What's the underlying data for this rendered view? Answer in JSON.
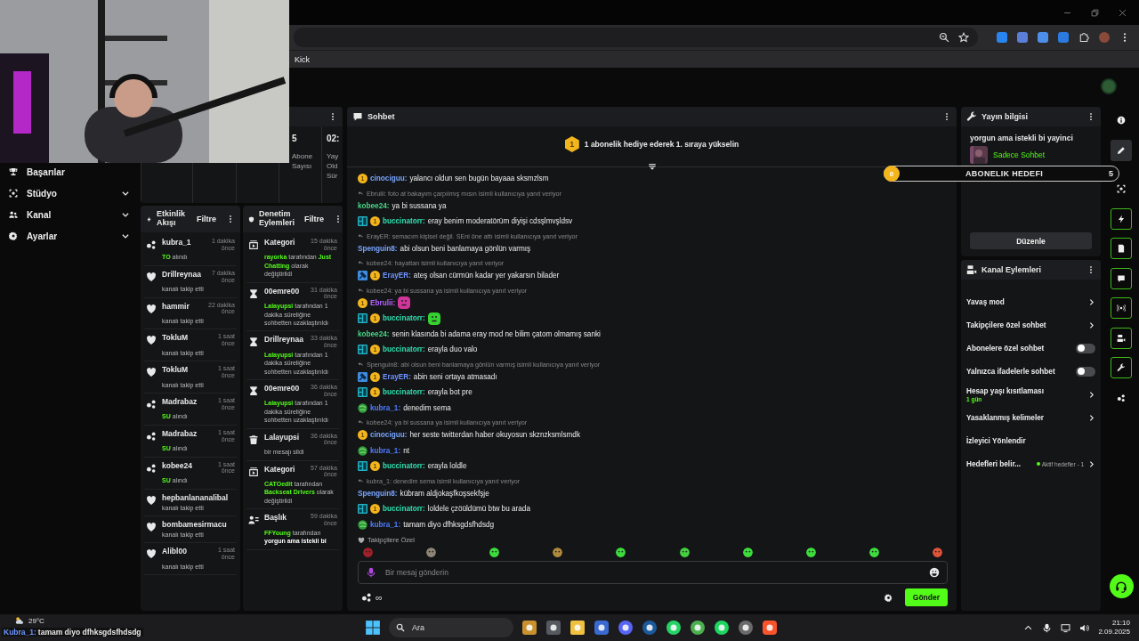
{
  "browser": {
    "bookmarks": [
      {
        "label": "Kick"
      }
    ]
  },
  "sidebar": {
    "items": [
      {
        "label": "Başarılar",
        "kind": "link"
      },
      {
        "label": "Stüdyo",
        "kind": "group"
      },
      {
        "label": "Kanal",
        "kind": "group"
      },
      {
        "label": "Ayarlar",
        "kind": "group"
      }
    ]
  },
  "stats": {
    "cells": [
      {
        "value": "5",
        "label": "Abone Sayısı"
      },
      {
        "value": "02:",
        "label": "Yay Old Sür"
      }
    ]
  },
  "activity_feed": {
    "title": "Etkinlik Akışı",
    "filter": "Filtre",
    "items": [
      {
        "kind": "gift",
        "user": "kubra_1",
        "time": "1 dakika önce",
        "parts": [
          {
            "kind": "accent",
            "text": "TO"
          },
          {
            "kind": "plain",
            "text": " alındı"
          }
        ]
      },
      {
        "kind": "follow",
        "user": "Drillreynaa",
        "time": "7 dakika önce",
        "parts": [
          {
            "kind": "plain",
            "text": "kanalı takip etti"
          }
        ]
      },
      {
        "kind": "follow",
        "user": "hammir",
        "time": "22 dakika önce",
        "parts": [
          {
            "kind": "plain",
            "text": "kanalı takip etti"
          }
        ]
      },
      {
        "kind": "follow",
        "user": "TokluM",
        "time": "1 saat önce",
        "parts": [
          {
            "kind": "plain",
            "text": "kanalı takip etti"
          }
        ]
      },
      {
        "kind": "follow",
        "user": "TokluM",
        "time": "1 saat önce",
        "parts": [
          {
            "kind": "plain",
            "text": "kanalı takip etti"
          }
        ]
      },
      {
        "kind": "gift",
        "user": "Madrabaz",
        "time": "1 saat önce",
        "parts": [
          {
            "kind": "accent",
            "text": "SU"
          },
          {
            "kind": "plain",
            "text": " alındı"
          }
        ]
      },
      {
        "kind": "gift",
        "user": "Madrabaz",
        "time": "1 saat önce",
        "parts": [
          {
            "kind": "accent",
            "text": "SU"
          },
          {
            "kind": "plain",
            "text": " alındı"
          }
        ]
      },
      {
        "kind": "gift",
        "user": "kobee24",
        "time": "1 saat önce",
        "parts": [
          {
            "kind": "accent",
            "text": "SU"
          },
          {
            "kind": "plain",
            "text": " alındı"
          }
        ]
      },
      {
        "kind": "follow",
        "user": "hepbanlananalibal",
        "parts": [
          {
            "kind": "plain",
            "text": "kanalı takip etti"
          }
        ]
      },
      {
        "kind": "follow",
        "user": "bombamesirmacu",
        "parts": [
          {
            "kind": "plain",
            "text": "kanalı takip etti"
          }
        ]
      },
      {
        "kind": "follow",
        "user": "Alibl00",
        "time": "1 saat önce",
        "parts": [
          {
            "kind": "plain",
            "text": "kanalı takip etti"
          }
        ]
      }
    ]
  },
  "moderation_feed": {
    "title": "Denetim Eylemleri",
    "filter": "Filtre",
    "items": [
      {
        "kind": "category",
        "user": "Kategori",
        "time": "15 dakika önce",
        "parts": [
          {
            "kind": "accent",
            "text": "rayorka"
          },
          {
            "kind": "plain",
            "text": " tarafından "
          },
          {
            "kind": "accent",
            "text": "Just Chatting"
          },
          {
            "kind": "plain",
            "text": " olarak değiştirildi"
          }
        ]
      },
      {
        "kind": "timeout",
        "user": "00emre00",
        "time": "31 dakika önce",
        "parts": [
          {
            "kind": "accent",
            "text": "Lalayupsi"
          },
          {
            "kind": "plain",
            "text": " tarafından 1 dakika süreliğine sohbetten uzaklaştırıldı"
          }
        ]
      },
      {
        "kind": "timeout",
        "user": "Drillreynaa",
        "time": "33 dakika önce",
        "parts": [
          {
            "kind": "accent",
            "text": "Lalayupsi"
          },
          {
            "kind": "plain",
            "text": " tarafından 1 dakika süreliğine sohbetten uzaklaştırıldı"
          }
        ]
      },
      {
        "kind": "timeout",
        "user": "00emre00",
        "time": "36 dakika önce",
        "parts": [
          {
            "kind": "accent",
            "text": "Lalayupsi"
          },
          {
            "kind": "plain",
            "text": " tarafından 1 dakika süreliğine sohbetten uzaklaştırıldı"
          }
        ]
      },
      {
        "kind": "delete",
        "user": "Lalayupsi",
        "time": "36 dakika önce",
        "parts": [
          {
            "kind": "plain",
            "text": "bir mesajı sildi"
          }
        ]
      },
      {
        "kind": "category",
        "user": "Kategori",
        "time": "57 dakika önce",
        "parts": [
          {
            "kind": "accent",
            "text": "CATOedit"
          },
          {
            "kind": "plain",
            "text": " tarafından "
          },
          {
            "kind": "accent",
            "text": "Backseat Drivers"
          },
          {
            "kind": "plain",
            "text": " olarak değiştirildi"
          }
        ]
      },
      {
        "kind": "title",
        "user": "Başlık",
        "time": "59 dakika önce",
        "parts": [
          {
            "kind": "accent",
            "text": "FFYoung"
          },
          {
            "kind": "plain",
            "text": " tarafından "
          },
          {
            "kind": "strong",
            "text": "yorgun ama istekli bi"
          }
        ]
      }
    ]
  },
  "chat": {
    "title": "Sohbet",
    "pinned": {
      "rank": "1",
      "text": "1 abonelik hediye ederek 1. sıraya yükselin"
    },
    "messages": [
      {
        "badges": [
          {
            "kind": "sub",
            "label": "1"
          }
        ],
        "user": "cinociguu:",
        "color": "#7aa6ff",
        "text": "yalancı oldun sen bugün bayaaa sksmzlsm"
      },
      {
        "reply": "Ebrulii: foto at bakayım çarpılmış mısın isimli kullanıcıya yanıt veriyor",
        "user": "kobee24:",
        "color": "#45d483",
        "text": "ya bi sussana ya"
      },
      {
        "badges": [
          {
            "kind": "mod"
          },
          {
            "kind": "sub",
            "label": "1"
          }
        ],
        "user": "buccinatorr:",
        "color": "#2fe0b0",
        "text": "eray benim moderatörüm diyişi cdsşlmvşldsv"
      },
      {
        "reply": "ErayER: semacım kişisel değil. SEni öne attı isimli kullanıcıya yanıt veriyor",
        "user": "Spenguin8:",
        "color": "#7aa6ff",
        "text": "abi olsun beni banlamaya gönlün varmış"
      },
      {
        "reply": "kobee24: hayattan isimli kullanıcıya yanıt veriyor",
        "badges": [
          {
            "kind": "staff"
          },
          {
            "kind": "sub",
            "label": "1"
          }
        ],
        "user": "ErayER:",
        "color": "#6f95ff",
        "text": "ateş olsan cürmün kadar yer yakarsın bilader"
      },
      {
        "reply": "kobee24: ya bi sussana ya isimli kullanıcıya yanıt veriyor",
        "badges": [
          {
            "kind": "sub",
            "label": "1"
          }
        ],
        "user": "Ebrulii:",
        "color": "#b463ff",
        "emote": {
          "color": "#d0359a"
        }
      },
      {
        "badges": [
          {
            "kind": "mod"
          },
          {
            "kind": "sub",
            "label": "1"
          }
        ],
        "user": "buccinatorr:",
        "color": "#2fe0b0",
        "emote": {
          "color": "#35d22f"
        }
      },
      {
        "user": "kobee24:",
        "color": "#45d483",
        "text": "senin klasında bi adama eray mod ne bilim çatom olmamış sanki"
      },
      {
        "badges": [
          {
            "kind": "mod"
          },
          {
            "kind": "sub",
            "label": "1"
          }
        ],
        "user": "buccinatorr:",
        "color": "#2fe0b0",
        "text": "erayla duo valo"
      },
      {
        "reply": "Spenguin8: abi olsun beni banlamaya gönlün varmış isimli kullanıcıya yanıt veriyor",
        "badges": [
          {
            "kind": "staff"
          },
          {
            "kind": "sub",
            "label": "1"
          }
        ],
        "user": "ErayER:",
        "color": "#6f95ff",
        "text": "abin seni ortaya atmasadı"
      },
      {
        "badges": [
          {
            "kind": "mod"
          },
          {
            "kind": "sub",
            "label": "1"
          }
        ],
        "user": "buccinatorr:",
        "color": "#2fe0b0",
        "text": "erayla bot pre"
      },
      {
        "badges": [
          {
            "kind": "og"
          }
        ],
        "user": "kubra_1:",
        "color": "#4f7dff",
        "text": "denedim sema"
      },
      {
        "reply": "kobee24: ya bi sussana ya isimli kullanıcıya yanıt veriyor",
        "badges": [
          {
            "kind": "sub",
            "label": "1"
          }
        ],
        "user": "cinociguu:",
        "color": "#7aa6ff",
        "text": "her seste twitterdan haber okuyosun skznzksmlsmdk"
      },
      {
        "badges": [
          {
            "kind": "og"
          }
        ],
        "user": "kubra_1:",
        "color": "#4f7dff",
        "text": "nt"
      },
      {
        "badges": [
          {
            "kind": "mod"
          },
          {
            "kind": "sub",
            "label": "1"
          }
        ],
        "user": "buccinatorr:",
        "color": "#2fe0b0",
        "text": "erayla loldle"
      },
      {
        "reply": "kubra_1: denedim sema isimli kullanıcıya yanıt veriyor",
        "user": "Spenguin8:",
        "color": "#7aa6ff",
        "text": "kübram aldjokaşfkoşsekfşje"
      },
      {
        "badges": [
          {
            "kind": "mod"
          },
          {
            "kind": "sub",
            "label": "1"
          }
        ],
        "user": "buccinatorr:",
        "color": "#2fe0b0",
        "text": "loldele çzöüldümü btw bu arada"
      },
      {
        "badges": [
          {
            "kind": "og"
          }
        ],
        "user": "kubra_1:",
        "color": "#4f7dff",
        "text": "tamam diyo dfhksgdsfhdsdg"
      }
    ],
    "emote_label": "Takipçilere Özel",
    "emote_bar": [
      {
        "color": "#a0202a"
      },
      {
        "color": "#8c8575"
      },
      {
        "color": "#3ddc3d"
      },
      {
        "color": "#b08a3c"
      },
      {
        "color": "#3ddc3d"
      },
      {
        "color": "#45d040"
      },
      {
        "color": "#3ddc3d"
      },
      {
        "color": "#3ddc3d"
      },
      {
        "color": "#3ddc3d"
      },
      {
        "color": "#e0553a"
      }
    ],
    "input": {
      "placeholder": "Bir mesaj gönderin"
    },
    "footer_count": "∞",
    "send": "Gönder"
  },
  "stream_info": {
    "title_label": "Yayın bilgisi",
    "stream_title": "yorgun ama istekli bi yayinci",
    "category": "Sadece Sohbet",
    "edit": "Düzenle"
  },
  "channel_actions": {
    "title": "Kanal Eylemleri",
    "items": [
      {
        "kind": "link",
        "label": "Yavaş mod"
      },
      {
        "kind": "link",
        "label": "Takipçilere özel sohbet"
      },
      {
        "kind": "toggle",
        "label": "Abonelere özel sohbet",
        "on": false
      },
      {
        "kind": "toggle",
        "label": "Yalnızca ifadelerle sohbet",
        "on": false
      },
      {
        "kind": "link",
        "label": "Hesap yaşı kısıtlaması",
        "sub": "1 gün"
      },
      {
        "kind": "link",
        "label": "Yasaklanmış kelimeler"
      },
      {
        "kind": "plain",
        "label": "İzleyici Yönlendir"
      },
      {
        "kind": "status",
        "label": "Hedefleri belir...",
        "status": "Aktif hedefler - 1"
      }
    ]
  },
  "rail": {
    "items": [
      {
        "selected": false,
        "pinned": false
      },
      {
        "selected": true,
        "pinned": false
      },
      {
        "selected": false,
        "pinned": false
      },
      {
        "selected": false,
        "pinned": true
      },
      {
        "selected": false,
        "pinned": true
      },
      {
        "selected": false,
        "pinned": true
      },
      {
        "selected": false,
        "pinned": true
      },
      {
        "selected": false,
        "pinned": true
      },
      {
        "selected": false,
        "pinned": true
      },
      {
        "selected": false,
        "pinned": false
      }
    ]
  },
  "overlay_goal": {
    "current": "0",
    "label": "ABONELIK HEDEFI",
    "target": "5"
  },
  "overlay_chat": {
    "user": "Kubra_1:",
    "text": "tamam diyo dfhksgdsfhdsdg"
  },
  "taskbar": {
    "weather": "29°C",
    "search": {
      "placeholder": "Ara"
    },
    "time": "21:10",
    "date": "2.09.2025"
  }
}
